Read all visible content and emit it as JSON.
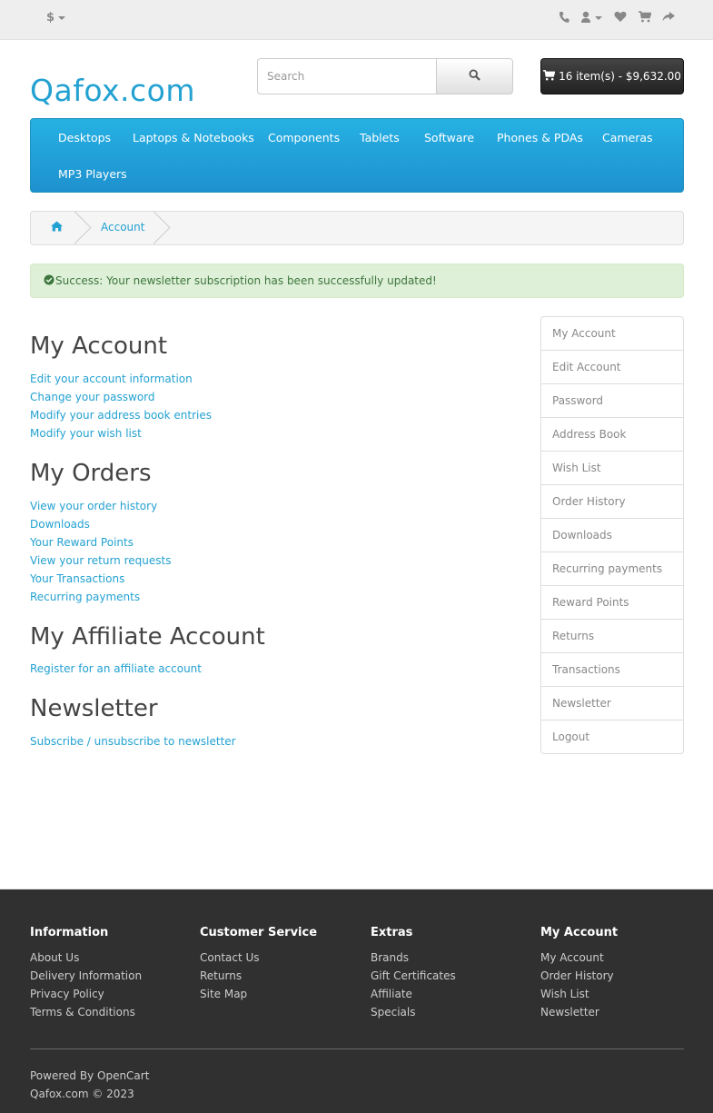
{
  "topbar": {
    "currency_symbol": "$",
    "icons": [
      "phone-icon",
      "user-icon",
      "heart-icon",
      "shopping-cart-icon",
      "share-icon"
    ]
  },
  "header": {
    "logo": "Qafox.com",
    "search_placeholder": "Search",
    "cart_label": "16 item(s) - $9,632.00"
  },
  "menu": {
    "items": [
      "Desktops",
      "Laptops & Notebooks",
      "Components",
      "Tablets",
      "Software",
      "Phones & PDAs",
      "Cameras",
      "MP3 Players"
    ]
  },
  "breadcrumb": {
    "account": "Account"
  },
  "alert": {
    "message": "Success: Your newsletter subscription has been successfully updated!"
  },
  "content": {
    "my_account": {
      "title": "My Account",
      "links": [
        "Edit your account information",
        "Change your password",
        "Modify your address book entries",
        "Modify your wish list"
      ]
    },
    "my_orders": {
      "title": "My Orders",
      "links": [
        "View your order history",
        "Downloads",
        "Your Reward Points",
        "View your return requests",
        "Your Transactions",
        "Recurring payments"
      ]
    },
    "affiliate": {
      "title": "My Affiliate Account",
      "links": [
        "Register for an affiliate account"
      ]
    },
    "newsletter": {
      "title": "Newsletter",
      "links": [
        "Subscribe / unsubscribe to newsletter"
      ]
    }
  },
  "sidebar": {
    "items": [
      "My Account",
      "Edit Account",
      "Password",
      "Address Book",
      "Wish List",
      "Order History",
      "Downloads",
      "Recurring payments",
      "Reward Points",
      "Returns",
      "Transactions",
      "Newsletter",
      "Logout"
    ]
  },
  "footer": {
    "columns": [
      {
        "title": "Information",
        "links": [
          "About Us",
          "Delivery Information",
          "Privacy Policy",
          "Terms & Conditions"
        ]
      },
      {
        "title": "Customer Service",
        "links": [
          "Contact Us",
          "Returns",
          "Site Map"
        ]
      },
      {
        "title": "Extras",
        "links": [
          "Brands",
          "Gift Certificates",
          "Affiliate",
          "Specials"
        ]
      },
      {
        "title": "My Account",
        "links": [
          "My Account",
          "Order History",
          "Wish List",
          "Newsletter"
        ]
      }
    ],
    "powered_prefix": "Powered By",
    "powered_link": "OpenCart",
    "copyright": "Qafox.com © 2023"
  },
  "colors": {
    "link": "#23a1d1",
    "menu_bg": "#229ac8",
    "alert_bg": "#dff0d8",
    "alert_text": "#3c763d",
    "footer_bg": "#303030"
  }
}
